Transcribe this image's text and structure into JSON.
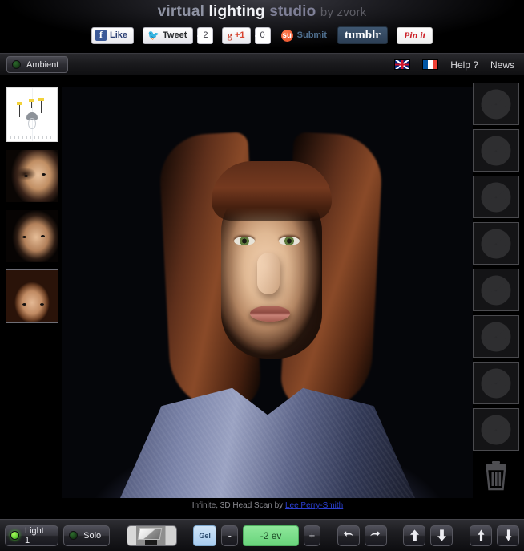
{
  "header": {
    "title_parts": {
      "virtual": "virtual",
      "lighting": "lighting",
      "studio": "studio",
      "by": "by zvork"
    },
    "social": {
      "facebook_label": "Like",
      "facebook_glyph": "f",
      "twitter_label": "Tweet",
      "twitter_count": "2",
      "google_label": "+1",
      "google_glyph": "g",
      "google_count": "0",
      "stumble_label": "Submit",
      "stumble_glyph": "su",
      "tumblr_label": "tumblr",
      "pinterest_label": "Pin it"
    }
  },
  "topbar": {
    "ambient_label": "Ambient",
    "flag_uk": "united-kingdom-flag",
    "flag_fr": "france-flag",
    "help_label": "Help ?",
    "news_label": "News"
  },
  "left_rail": {
    "diagram_name": "light-setup-diagram",
    "thumbnails": [
      {
        "name": "model-thumbnail-bald-man",
        "selected": false
      },
      {
        "name": "model-thumbnail-man",
        "selected": false
      },
      {
        "name": "model-thumbnail-woman",
        "selected": true
      }
    ]
  },
  "render": {
    "model_name": "infinite-3d-head-scan",
    "caption_prefix": "Infinite, 3D Head Scan by ",
    "caption_link": "Lee Perry-Smith"
  },
  "right_rail": {
    "slot_icon": "aperture-iris-icon",
    "slots": [
      {
        "label": "light-slot-1"
      },
      {
        "label": "light-slot-2"
      },
      {
        "label": "light-slot-3"
      },
      {
        "label": "light-slot-4"
      },
      {
        "label": "light-slot-5"
      },
      {
        "label": "light-slot-6"
      },
      {
        "label": "light-slot-7"
      },
      {
        "label": "light-slot-8"
      }
    ],
    "trash_label": "trash-can-icon"
  },
  "bottombar": {
    "light_label": "Light 1",
    "light_led": "on",
    "solo_label": "Solo",
    "solo_led": "off",
    "shape_label": "softbox-shape-preview",
    "gel_label": "Gel",
    "minus_label": "-",
    "ev_value": "-2 ev",
    "plus_label": "+",
    "rotate_left_label": "rotate-left",
    "rotate_right_label": "rotate-right",
    "move_up_label": "move-up",
    "move_down_label": "move-down",
    "raise_label": "raise",
    "lower_label": "lower"
  },
  "colors": {
    "accent_green": "#69d47c",
    "accent_blue": "#a9cdf0",
    "led_on": "#4ad42a",
    "link_blue": "#2b3fd0"
  }
}
